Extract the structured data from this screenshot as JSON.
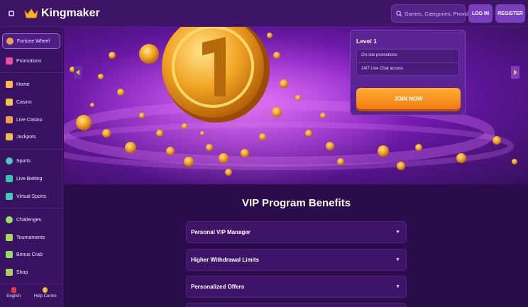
{
  "header": {
    "brand": "Kingmaker",
    "search_placeholder": "Games, Categories, Providers",
    "login_label": "LOG IN",
    "register_label": "REGISTER"
  },
  "sidebar": {
    "items": [
      {
        "label": "Fortune Wheel",
        "icon": "wheel-icon",
        "color": "#f0a24a"
      },
      {
        "label": "Promotions",
        "icon": "gift-icon",
        "color": "#e84f9c"
      },
      {
        "label": "Home",
        "icon": "home-icon",
        "color": "#ffb84a"
      },
      {
        "label": "Casino",
        "icon": "slot-machine-icon",
        "color": "#f5c24b"
      },
      {
        "label": "Live Casino",
        "icon": "cards-icon",
        "color": "#f0a14b"
      },
      {
        "label": "Jackpots",
        "icon": "jackpot-icon",
        "color": "#f5b94d"
      },
      {
        "label": "Sports",
        "icon": "ball-icon",
        "color": "#4cc8c0"
      },
      {
        "label": "Live Betting",
        "icon": "live-icon",
        "color": "#36c6b0"
      },
      {
        "label": "Virtual Sports",
        "icon": "gamepad-icon",
        "color": "#43c9bd"
      },
      {
        "label": "Challenges",
        "icon": "target-icon",
        "color": "#9bdc63"
      },
      {
        "label": "Tournaments",
        "icon": "trophy-icon",
        "color": "#a5d85b"
      },
      {
        "label": "Bonus Crab",
        "icon": "crab-icon",
        "color": "#9bd868"
      },
      {
        "label": "Shop",
        "icon": "shop-icon",
        "color": "#a2d75f"
      }
    ],
    "bottom": [
      {
        "label": "English",
        "icon": "flag-icon",
        "color": "#e03a3a"
      },
      {
        "label": "Help Centre",
        "icon": "help-icon",
        "color": "#f5b942"
      }
    ]
  },
  "level_card": {
    "title": "Level 1",
    "benefits": [
      "On-site promotions",
      "24/7 Live Chat access"
    ],
    "cta": "JOIN NOW"
  },
  "vip": {
    "title": "VIP Program Benefits",
    "items": [
      {
        "label": "Personal VIP Manager"
      },
      {
        "label": "Higher Withdrawal Limits"
      },
      {
        "label": "Personalized Offers"
      }
    ]
  },
  "colors": {
    "accent": "#7a3fc0",
    "cta": "#f59120",
    "background": "#2a0d4a"
  }
}
